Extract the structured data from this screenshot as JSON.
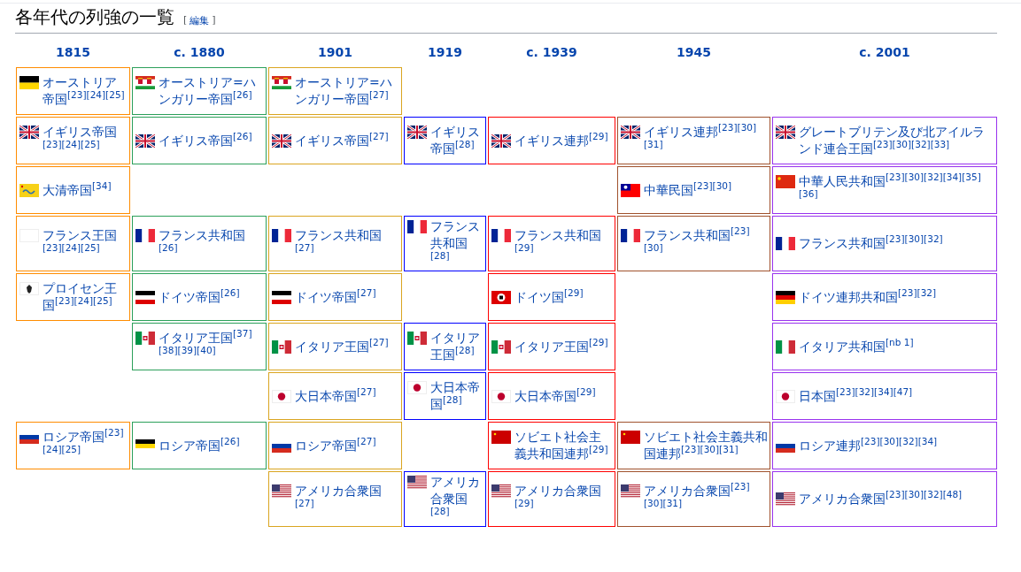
{
  "heading": {
    "title": "各年代の列強の一覧",
    "bracket_open": "[",
    "edit_link": "編集",
    "bracket_close": "]"
  },
  "columns": [
    {
      "year": "1815",
      "color": "#ff8c00"
    },
    {
      "year": "c. 1880",
      "color": "#2ca05a"
    },
    {
      "year": "1901",
      "color": "#daa520"
    },
    {
      "year": "1919",
      "color": "#0000ff"
    },
    {
      "year": "c. 1939",
      "color": "#ff0000"
    },
    {
      "year": "1945",
      "color": "#a0522d"
    },
    {
      "year": "c. 2001",
      "color": "#9933ee"
    }
  ],
  "rows": [
    {
      "cells": [
        {
          "kind": "austria",
          "name": "オーストリア帝国",
          "refs": "[23][24][25]"
        },
        {
          "kind": "austria-hungary",
          "name": "オーストリア=ハンガリー帝国",
          "refs": "[26]"
        },
        {
          "kind": "austria-hungary",
          "name": "オーストリア=ハンガリー帝国",
          "refs": "[27]"
        },
        {
          "kind": "empty"
        },
        {
          "kind": "empty"
        },
        {
          "kind": "empty"
        },
        {
          "kind": "empty"
        }
      ]
    },
    {
      "cells": [
        {
          "kind": "uk",
          "name": "イギリス帝国",
          "refs": "[23][24][25]"
        },
        {
          "kind": "uk",
          "name": "イギリス帝国",
          "refs": "[26]"
        },
        {
          "kind": "uk",
          "name": "イギリス帝国",
          "refs": "[27]"
        },
        {
          "kind": "uk",
          "name": "イギリス帝国",
          "refs": "[28]"
        },
        {
          "kind": "uk",
          "name": "イギリス連邦",
          "refs": "[29]"
        },
        {
          "kind": "uk",
          "name": "イギリス連邦",
          "refs": "[23][30][31]"
        },
        {
          "kind": "uk",
          "name": "グレートブリテン及び北アイルランド連合王国",
          "refs": "[23][30][32][33]"
        }
      ]
    },
    {
      "cells": [
        {
          "kind": "qing",
          "name": "大清帝国",
          "refs": "[34]"
        },
        {
          "kind": "empty"
        },
        {
          "kind": "empty"
        },
        {
          "kind": "empty"
        },
        {
          "kind": "empty"
        },
        {
          "kind": "roc",
          "name": "中華民国",
          "refs": "[23][30]"
        },
        {
          "kind": "prc",
          "name": "中華人民共和国",
          "refs": "[23][30][32][34][35][36]"
        }
      ]
    },
    {
      "cells": [
        {
          "kind": "white",
          "name": "フランス王国",
          "refs": "[23][24][25]"
        },
        {
          "kind": "france",
          "name": "フランス共和国",
          "refs": "[26]"
        },
        {
          "kind": "france",
          "name": "フランス共和国",
          "refs": "[27]"
        },
        {
          "kind": "france",
          "name": "フランス共和国",
          "refs": "[28]"
        },
        {
          "kind": "france",
          "name": "フランス共和国",
          "refs": "[29]"
        },
        {
          "kind": "france",
          "name": "フランス共和国",
          "refs": "[23][30]"
        },
        {
          "kind": "france",
          "name": "フランス共和国",
          "refs": "[23][30][32]"
        }
      ]
    },
    {
      "cells": [
        {
          "kind": "prussia",
          "name": "プロイセン王国",
          "refs": "[23][24][25]"
        },
        {
          "kind": "german-empire",
          "name": "ドイツ帝国",
          "refs": "[26]"
        },
        {
          "kind": "german-empire",
          "name": "ドイツ帝国",
          "refs": "[27]"
        },
        {
          "kind": "empty"
        },
        {
          "kind": "reich",
          "name": "ドイツ国",
          "refs": "[29]"
        },
        {
          "kind": "empty"
        },
        {
          "kind": "germany",
          "name": "ドイツ連邦共和国",
          "refs": "[23][32]"
        }
      ]
    },
    {
      "cells": [
        {
          "kind": "empty"
        },
        {
          "kind": "italy-kingdom",
          "name": "イタリア王国",
          "refs": "[37][38][39][40]"
        },
        {
          "kind": "italy-kingdom",
          "name": "イタリア王国",
          "refs": "[27]"
        },
        {
          "kind": "italy-kingdom",
          "name": "イタリア王国",
          "refs": "[28]"
        },
        {
          "kind": "italy-kingdom",
          "name": "イタリア王国",
          "refs": "[29]"
        },
        {
          "kind": "empty"
        },
        {
          "kind": "italy",
          "name": "イタリア共和国",
          "refs": "[nb 1]"
        }
      ]
    },
    {
      "cells": [
        {
          "kind": "empty"
        },
        {
          "kind": "empty"
        },
        {
          "kind": "japan",
          "name": "大日本帝国",
          "refs": "[27]"
        },
        {
          "kind": "japan",
          "name": "大日本帝国",
          "refs": "[28]"
        },
        {
          "kind": "japan",
          "name": "大日本帝国",
          "refs": "[29]"
        },
        {
          "kind": "empty"
        },
        {
          "kind": "japan",
          "name": "日本国",
          "refs": "[23][32][34][47]"
        }
      ]
    },
    {
      "cells": [
        {
          "kind": "russia",
          "name": "ロシア帝国",
          "refs": "[23][24][25]"
        },
        {
          "kind": "russia-imperial",
          "name": "ロシア帝国",
          "refs": "[26]"
        },
        {
          "kind": "russia",
          "name": "ロシア帝国",
          "refs": "[27]"
        },
        {
          "kind": "empty"
        },
        {
          "kind": "ussr",
          "name": "ソビエト社会主義共和国連邦",
          "refs": "[29]"
        },
        {
          "kind": "ussr",
          "name": "ソビエト社会主義共和国連邦",
          "refs": "[23][30][31]"
        },
        {
          "kind": "russia",
          "name": "ロシア連邦",
          "refs": "[23][30][32][34]"
        }
      ]
    },
    {
      "cells": [
        {
          "kind": "empty"
        },
        {
          "kind": "empty"
        },
        {
          "kind": "usa",
          "name": "アメリカ合衆国",
          "refs": "[27]"
        },
        {
          "kind": "usa",
          "name": "アメリカ合衆国",
          "refs": "[28]"
        },
        {
          "kind": "usa",
          "name": "アメリカ合衆国",
          "refs": "[29]"
        },
        {
          "kind": "usa",
          "name": "アメリカ合衆国",
          "refs": "[23][30][31]"
        },
        {
          "kind": "usa",
          "name": "アメリカ合衆国",
          "refs": "[23][30][32][48]"
        }
      ]
    }
  ]
}
